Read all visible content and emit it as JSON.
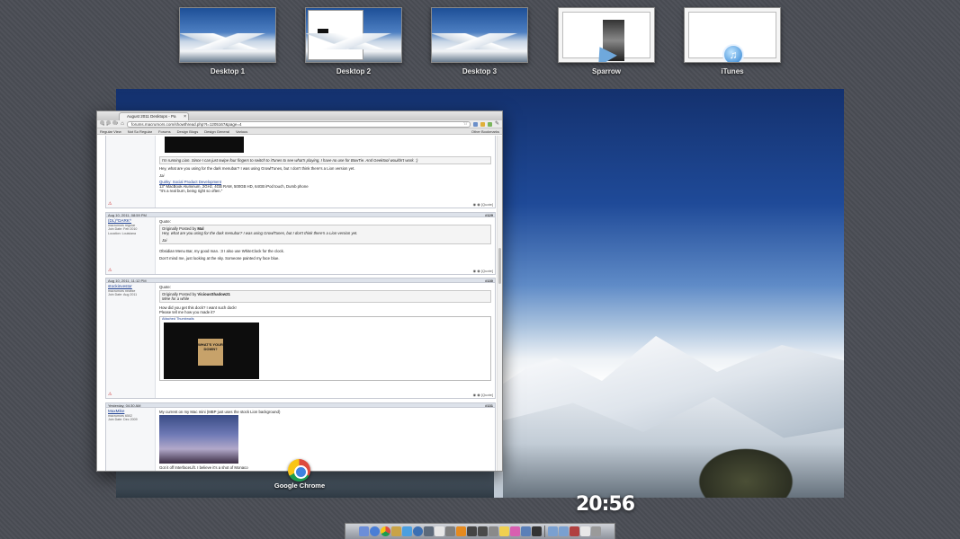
{
  "spaces": [
    {
      "label": "Desktop 1"
    },
    {
      "label": "Desktop 2"
    },
    {
      "label": "Desktop 3"
    },
    {
      "label": "Sparrow"
    },
    {
      "label": "iTunes"
    }
  ],
  "browser": {
    "tab_title": "August 2011 Desktops - Pa",
    "url": "forums.macrumors.com/showthread.php?t=1205167&page=4",
    "bookmarks": [
      "Regular View",
      "Not So Regular",
      "Forums",
      "Design Blogs",
      "Design General",
      "Various"
    ],
    "other_bookmarks": "Other Bookmarks"
  },
  "posts": [
    {
      "header": "",
      "number": "",
      "user": "",
      "body": [
        "I'm running Lion. Since I can just swipe four fingers to switch to iTunes to see what's playing, I have no use for BowTie. And Geektool wouldn't work. :)",
        "Hey, what are you using for the dark menubar? I was using GrowlTunes, but I don't think there's a Lion version yet.",
        "Jai"
      ],
      "sig_link": "Quirky: Social Product Development",
      "sig": "13\" MacBook Aluminum, 2GHz, 4GB RAM, 500GB HD, 64GB iPod touch, Dumb phone",
      "sig2": "\"It's a real burn, being right so often.\""
    },
    {
      "header": "Aug 10, 2011, 08:59 PM",
      "number": "#129",
      "user": "(DL)^DARK^",
      "user_meta": [
        "macrumors regular",
        "Join Date: Feb 2010",
        "Location: Louisiana"
      ],
      "quote_label": "Quote:",
      "quote_from": "Originally Posted by",
      "quote_author": "Mal",
      "quote_text": "Hey, what are you using for the dark menubar? I was using GrowlTunes, but I don't think there's a Lion version yet.",
      "quote_sig": "Jai",
      "body": [
        "Obsidian Menu Bar, my good man. :3 I also use WhiteClock for the clock.",
        "Don't mind me, just looking at the sky. Someone painted my face blue."
      ]
    },
    {
      "header": "Aug 10, 2011, 11:12 PM",
      "number": "#130",
      "user": "stockinvestor",
      "user_meta": [
        "macrumors newbie",
        "Join Date: Aug 2011"
      ],
      "quote_label": "Quote:",
      "quote_from": "Originally Posted by",
      "quote_author": "ViciousShadow21",
      "quote_text": "Mine for a while",
      "body": [
        "How did you get this dock? I want such dock!",
        "Please tell me how you made it?"
      ],
      "attachment_label": "Attached Thumbnails",
      "poster_text": "WHAT'S YOUR DOWN?"
    },
    {
      "header": "Yesterday, 04:30 AM",
      "number": "#131",
      "user": "MaxMike",
      "user_meta": [
        "macrumors 6502",
        "Join Date: Dec 2009"
      ],
      "body": [
        "My current on my Mac mini (MBP just uses the stock Lion background)",
        "Got it off InterfaceLift. I believe it's a shot of Monaco"
      ]
    }
  ],
  "chrome_label": "Google Chrome",
  "clock": "20:56"
}
